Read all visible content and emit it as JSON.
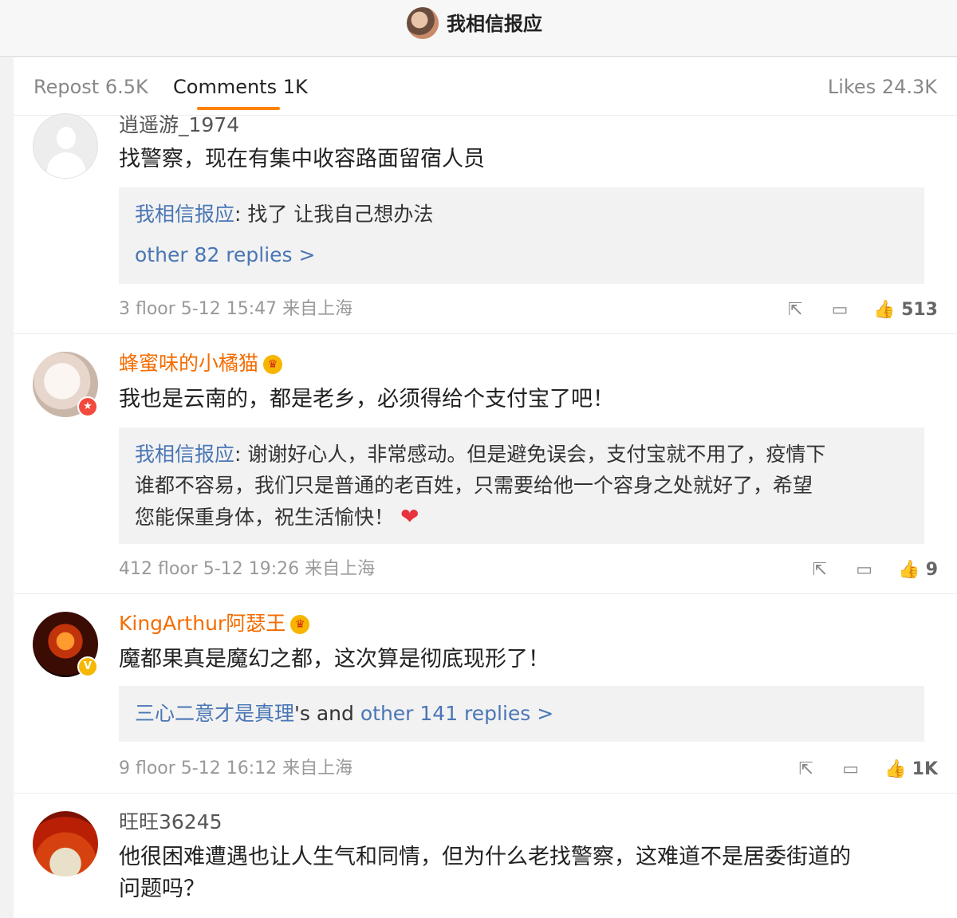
{
  "header": {
    "title": "我相信报应"
  },
  "tabs": {
    "repost": "Repost 6.5K",
    "comments": "Comments 1K",
    "likes": "Likes 24.3K"
  },
  "comments": [
    {
      "user": "逍遥游_1974",
      "text": "找警察，现在有集中收容路面留宿人员",
      "reply_author": "我相信报应",
      "reply_text": ": 找了  让我自己想办法",
      "more": "other 82 replies >",
      "meta": "3 floor 5-12 15:47 来自上海",
      "likes": "513"
    },
    {
      "user": "蜂蜜味的小橘猫",
      "text": "我也是云南的，都是老乡，必须得给个支付宝了吧！",
      "reply_author": "我相信报应",
      "reply_line1": ": 谢谢好心人，非常感动。但是避免误会，支付宝就不用了，疫情下",
      "reply_line2": "谁都不容易，我们只是普通的老百姓，只需要给他一个容身之处就好了，希望",
      "reply_line3": "您能保重身体，祝生活愉快！",
      "meta": "412 floor 5-12 19:26 来自上海",
      "likes": "9"
    },
    {
      "user": "KingArthur阿瑟王",
      "text": "魔都果真是魔幻之都，这次算是彻底现形了！",
      "reply_author": "三心二意才是真理",
      "reply_mid": "'s and ",
      "more": "other 141 replies >",
      "meta": "9 floor 5-12 16:12 来自上海",
      "likes": "1K"
    },
    {
      "user": "旺旺36245",
      "text_line1": "他很困难遭遇也让人生气和同情，但为什么老找警察，这难道不是居委街道的",
      "text_line2": "问题吗？"
    }
  ]
}
